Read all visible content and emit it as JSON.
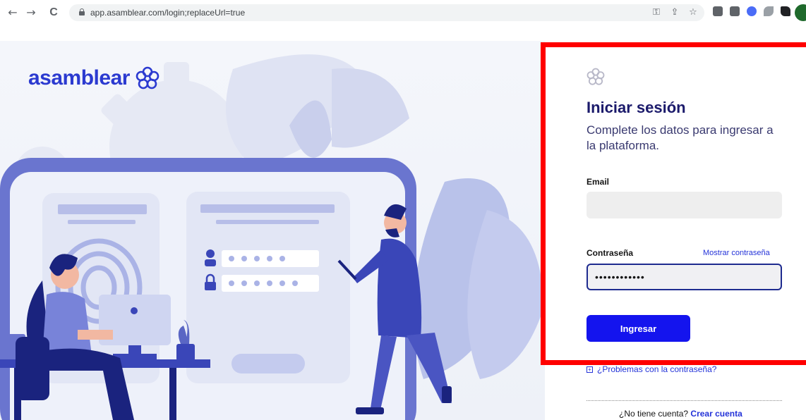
{
  "browser": {
    "url": "app.asamblear.com/login;replaceUrl=true",
    "nav": {
      "back": "←",
      "forward": "→",
      "reload": "C"
    },
    "omnibox_icons": [
      "key-icon",
      "share-icon",
      "bookmark-star-icon"
    ],
    "extensions": [
      "extension-1-icon",
      "extension-2-icon",
      "extension-3-icon",
      "extension-4-icon",
      "puzzle-icon",
      "side-panel-icon"
    ],
    "extension_colors": [
      "#5f6368",
      "#5f6368",
      "#4a6cf7",
      "#6b7280",
      "#202124",
      "#202124"
    ],
    "profile_color": "#1f6a2c"
  },
  "brand": {
    "name": "asamblear",
    "color": "#2b3ad0"
  },
  "login": {
    "title": "Iniciar sesión",
    "subtitle": "Complete los datos para ingresar a la plataforma.",
    "email_label": "Email",
    "email_value": "",
    "password_label": "Contraseña",
    "password_value": "••••••••••••",
    "show_password": "Mostrar contraseña",
    "submit": "Ingresar",
    "forgot": "¿Problemas con la contraseña?",
    "no_account": "¿No tiene cuenta?",
    "create_account": "Crear cuenta",
    "accent_color": "#1414ee",
    "highlight_color": "#ff0000"
  }
}
